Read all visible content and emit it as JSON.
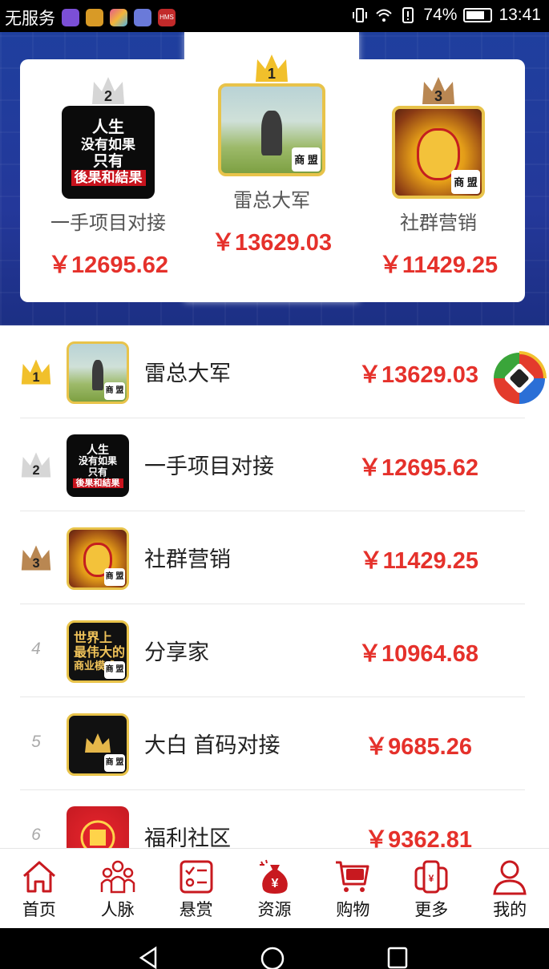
{
  "status_bar": {
    "carrier": "无服务",
    "app_icons": [
      {
        "name": "assistant-app-icon",
        "color": "#7b4fd6"
      },
      {
        "name": "package-app-icon",
        "color": "#d89a26"
      },
      {
        "name": "gallery-app-icon",
        "color": "#e45b8c"
      },
      {
        "name": "music-app-icon",
        "color": "#6a7ad9"
      },
      {
        "name": "hms-app-icon",
        "color": "#c22a2a",
        "text": "HMS"
      }
    ],
    "battery": "74%",
    "time": "13:41"
  },
  "podium": [
    {
      "rank": "2",
      "name": "一手项目对接",
      "amount": "￥12695.62",
      "crown_color": "#cfcfcf",
      "image": "dark",
      "image_lines": [
        "人生",
        "没有如果",
        "只有",
        "後果和結果"
      ]
    },
    {
      "rank": "1",
      "name": "雷总大军",
      "amount": "￥13629.03",
      "crown_color": "#f1c02b",
      "image": "field",
      "badge": "商 盟"
    },
    {
      "rank": "3",
      "name": "社群营销",
      "amount": "￥11429.25",
      "crown_color": "#b98752",
      "image": "cat",
      "badge": "商 盟"
    }
  ],
  "ranking": [
    {
      "rank": "1",
      "name": "雷总大军",
      "amount": "￥13629.03",
      "image": "field",
      "badge": "商 盟",
      "crown_color": "#f1c02b"
    },
    {
      "rank": "2",
      "name": "一手项目对接",
      "amount": "￥12695.62",
      "image": "dark",
      "image_lines": [
        "人生",
        "没有如果",
        "只有",
        "後果和結果"
      ],
      "crown_color": "#cfcfcf"
    },
    {
      "rank": "3",
      "name": "社群营销",
      "amount": "￥11429.25",
      "image": "cat",
      "badge": "商 盟",
      "crown_color": "#b98752"
    },
    {
      "rank": "4",
      "name": "分享家",
      "amount": "￥10964.68",
      "image": "share",
      "image_lines": [
        "世界上",
        "最伟大的",
        "商业模式"
      ],
      "badge": "商 盟"
    },
    {
      "rank": "5",
      "name": "大白 首码对接",
      "amount": "￥9685.26",
      "image": "dabai",
      "badge": "商 盟"
    },
    {
      "rank": "6",
      "name": "福利社区",
      "amount": "￥9362.81",
      "image": "fuli"
    }
  ],
  "tabbar": [
    {
      "label": "首页",
      "icon": "home-icon"
    },
    {
      "label": "人脉",
      "icon": "contacts-icon"
    },
    {
      "label": "悬赏",
      "icon": "task-list-icon"
    },
    {
      "label": "资源",
      "icon": "money-bag-icon"
    },
    {
      "label": "购物",
      "icon": "shopping-cart-icon"
    },
    {
      "label": "更多",
      "icon": "more-icon"
    },
    {
      "label": "我的",
      "icon": "profile-icon"
    }
  ],
  "colors": {
    "accent_red": "#e5312b",
    "tab_red": "#c8191f",
    "banner_blue": "#24389a",
    "gold": "#f1c02b"
  }
}
